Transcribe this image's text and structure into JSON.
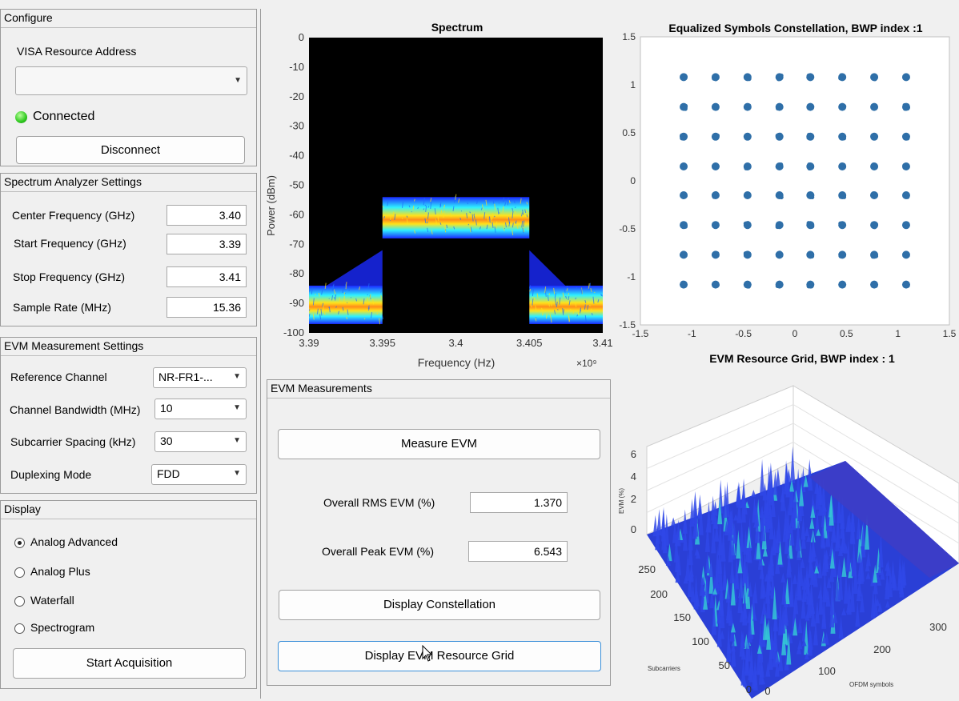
{
  "configure": {
    "title": "Configure",
    "visa_label": "VISA Resource Address",
    "visa_value": "",
    "status_text": "Connected",
    "status_color": "#2ec81e",
    "disconnect_label": "Disconnect"
  },
  "sa_settings": {
    "title": "Spectrum Analyzer Settings",
    "center_label": "Center Frequency (GHz)",
    "center_value": "3.40",
    "start_label": "Start Frequency (GHz)",
    "start_value": "3.39",
    "stop_label": "Stop Frequency (GHz)",
    "stop_value": "3.41",
    "rate_label": "Sample Rate (MHz)",
    "rate_value": "15.36"
  },
  "evm_settings": {
    "title": "EVM Measurement Settings",
    "ref_label": "Reference Channel",
    "ref_value": "NR-FR1-...",
    "bw_label": "Channel Bandwidth (MHz)",
    "bw_value": "10",
    "scs_label": "Subcarrier Spacing (kHz)",
    "scs_value": "30",
    "dup_label": "Duplexing Mode",
    "dup_value": "FDD"
  },
  "display": {
    "title": "Display",
    "options": [
      "Analog Advanced",
      "Analog Plus",
      "Waterfall",
      "Spectrogram"
    ],
    "selected": "Analog Advanced",
    "start_label": "Start Acquisition"
  },
  "evm_measurements": {
    "title": "EVM Measurements",
    "measure_label": "Measure EVM",
    "rms_label": "Overall RMS EVM (%)",
    "rms_value": "1.370",
    "peak_label": "Overall Peak EVM (%)",
    "peak_value": "6.543",
    "constellation_label": "Display Constellation",
    "grid_label": "Display EVM Resource Grid"
  },
  "spectrum": {
    "title": "Spectrum",
    "ylabel": "Power (dBm)",
    "xlabel": "Frequency (Hz)",
    "x_exponent": "×10⁹",
    "yticks": [
      "0",
      "-10",
      "-20",
      "-30",
      "-40",
      "-50",
      "-60",
      "-70",
      "-80",
      "-90",
      "-100"
    ],
    "xticks": [
      "3.39",
      "3.395",
      "3.4",
      "3.405",
      "3.41"
    ],
    "chart_data": {
      "type": "area",
      "title": "Spectrum",
      "xlabel": "Frequency (Hz)",
      "ylabel": "Power (dBm)",
      "xlim": [
        3.39,
        3.41
      ],
      "ylim": [
        -100,
        0
      ],
      "noise_floor_dBm": -90,
      "band_level_dBm": -60,
      "band_edges_GHz": [
        3.395,
        3.405
      ]
    }
  },
  "constellation": {
    "title": "Equalized Symbols Constellation, BWP index :1",
    "xticks": [
      "-1.5",
      "-1",
      "-0.5",
      "0",
      "0.5",
      "1",
      "1.5"
    ],
    "yticks": [
      "1.5",
      "1",
      "0.5",
      "0",
      "-0.5",
      "-1",
      "-1.5"
    ],
    "point_color": "#2f6fa8",
    "chart_data": {
      "type": "scatter",
      "title": "Equalized Symbols Constellation, BWP index :1",
      "xlim": [
        -1.5,
        1.5
      ],
      "ylim": [
        -1.5,
        1.5
      ],
      "levels": [
        -1.08,
        -0.77,
        -0.46,
        -0.15,
        0.15,
        0.46,
        0.77,
        1.08
      ]
    }
  },
  "resource_grid": {
    "title": "EVM Resource Grid, BWP index : 1",
    "zlabel": "EVM (%)",
    "zticks": [
      "6",
      "4",
      "2",
      "0"
    ],
    "subcarrier_label": "Subcarriers",
    "subcarrier_ticks": [
      "250",
      "200",
      "150",
      "100",
      "50",
      "0"
    ],
    "ofdm_label": "OFDM symbols",
    "ofdm_ticks": [
      "0",
      "100",
      "200",
      "300"
    ],
    "surface_color": "#2a3fd6"
  }
}
